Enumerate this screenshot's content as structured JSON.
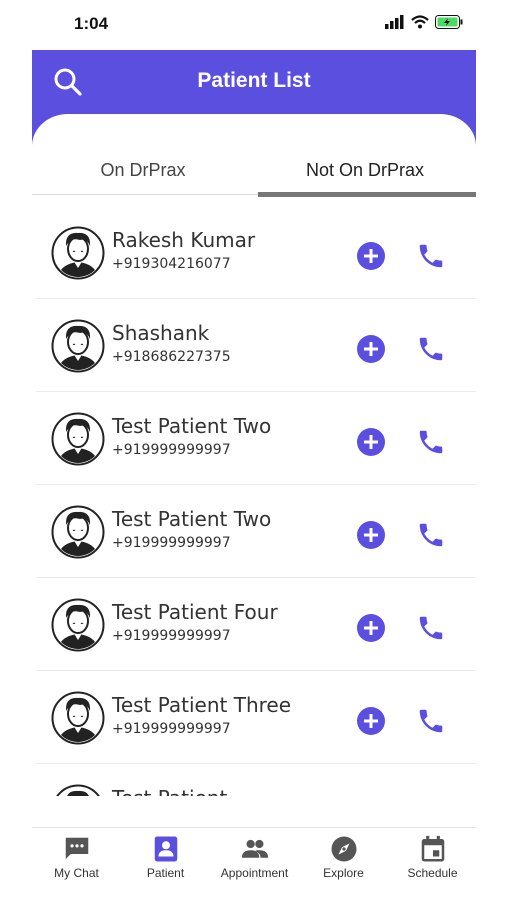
{
  "status_bar": {
    "time": "1:04"
  },
  "header": {
    "title": "Patient List"
  },
  "tabs": [
    {
      "label": "On DrPrax"
    },
    {
      "label": "Not On DrPrax"
    }
  ],
  "patients": [
    {
      "name": "Rakesh Kumar",
      "phone": "+919304216077"
    },
    {
      "name": "Shashank",
      "phone": "+918686227375"
    },
    {
      "name": "Test Patient Two",
      "phone": "+919999999997"
    },
    {
      "name": "Test Patient Two",
      "phone": "+919999999997"
    },
    {
      "name": "Test Patient Four",
      "phone": "+919999999997"
    },
    {
      "name": "Test Patient Three",
      "phone": "+919999999997"
    },
    {
      "name": "Test Patient",
      "phone": ""
    }
  ],
  "bottom_nav": [
    {
      "label": "My Chat",
      "icon": "chat-icon"
    },
    {
      "label": "Patient",
      "icon": "patient-icon"
    },
    {
      "label": "Appointment",
      "icon": "people-icon"
    },
    {
      "label": "Explore",
      "icon": "compass-icon"
    },
    {
      "label": "Schedule",
      "icon": "calendar-icon"
    }
  ],
  "colors": {
    "accent": "#5b4fe0",
    "nav_icon": "#555555"
  }
}
